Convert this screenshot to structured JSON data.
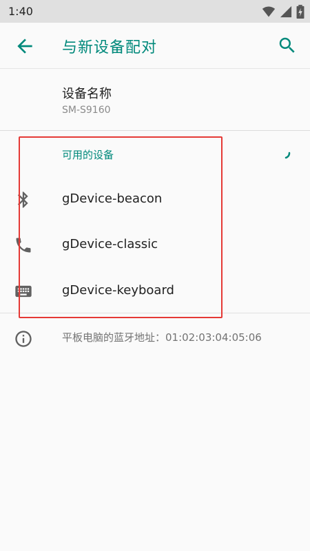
{
  "status_bar": {
    "time": "1:40"
  },
  "app_bar": {
    "title": "与新设备配对",
    "back_icon": "arrow-back-icon",
    "search_icon": "search-icon"
  },
  "device_name": {
    "title": "设备名称",
    "value": "SM-S9160"
  },
  "available_devices": {
    "header": "可用的设备",
    "items": [
      {
        "label": "gDevice-beacon",
        "icon": "bluetooth-icon"
      },
      {
        "label": "gDevice-classic",
        "icon": "phone-icon"
      },
      {
        "label": "gDevice-keyboard",
        "icon": "keyboard-icon"
      }
    ]
  },
  "info": {
    "text": "平板电脑的蓝牙地址：01:02:03:04:05:06",
    "icon": "info-icon"
  },
  "colors": {
    "accent": "#00897b",
    "highlight": "#e53935"
  }
}
